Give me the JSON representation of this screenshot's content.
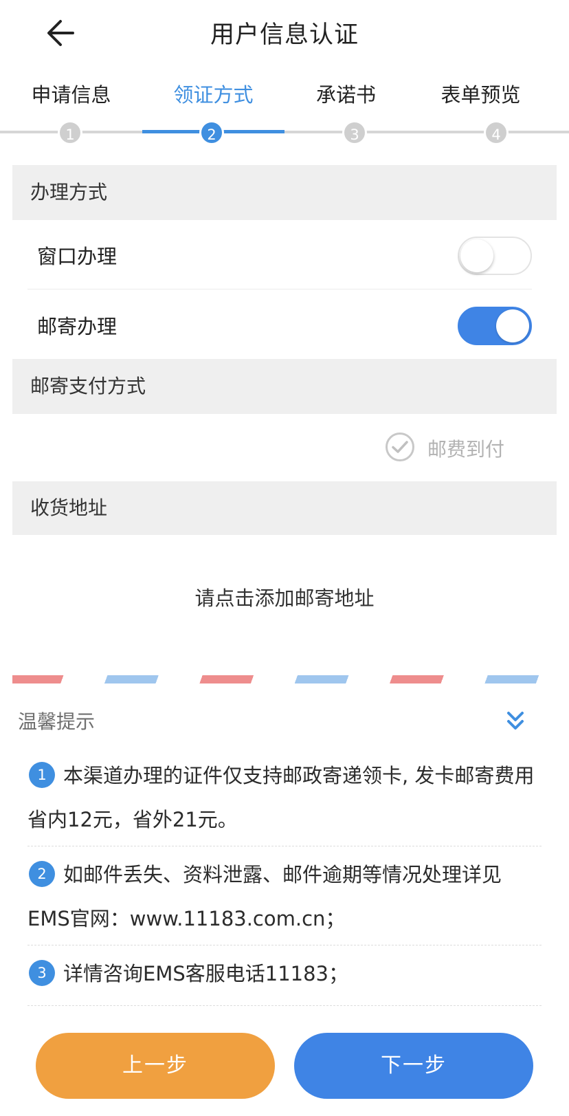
{
  "header": {
    "title": "用户信息认证",
    "back_icon": "arrow-left-icon"
  },
  "steps": [
    {
      "label": "申请信息",
      "number": "1",
      "active": false
    },
    {
      "label": "领证方式",
      "number": "2",
      "active": true
    },
    {
      "label": "承诺书",
      "number": "3",
      "active": false
    },
    {
      "label": "表单预览",
      "number": "4",
      "active": false
    }
  ],
  "handling": {
    "title": "办理方式",
    "options": [
      {
        "label": "窗口办理",
        "on": false
      },
      {
        "label": "邮寄办理",
        "on": true
      }
    ]
  },
  "payment": {
    "title": "邮寄支付方式",
    "option_label": "邮费到付"
  },
  "address": {
    "title": "收货地址",
    "add_prompt": "请点击添加邮寄地址"
  },
  "tips": {
    "title": "温馨提示",
    "collapse_icon": "double-chevron-down-icon",
    "items": [
      {
        "number": "1",
        "text": "本渠道办理的证件仅支持邮政寄递领卡, 发卡邮寄费用省内12元，省外21元。"
      },
      {
        "number": "2",
        "text": "如邮件丢失、资料泄露、邮件逾期等情况处理详见EMS官网：www.11183.com.cn；"
      },
      {
        "number": "3",
        "text": "详情咨询EMS客服电话11183；"
      }
    ]
  },
  "buttons": {
    "prev": "上一步",
    "next": "下一步"
  },
  "colors": {
    "accent": "#3f8fe0",
    "prev_button": "#f0a040",
    "next_button": "#3f84e5"
  }
}
